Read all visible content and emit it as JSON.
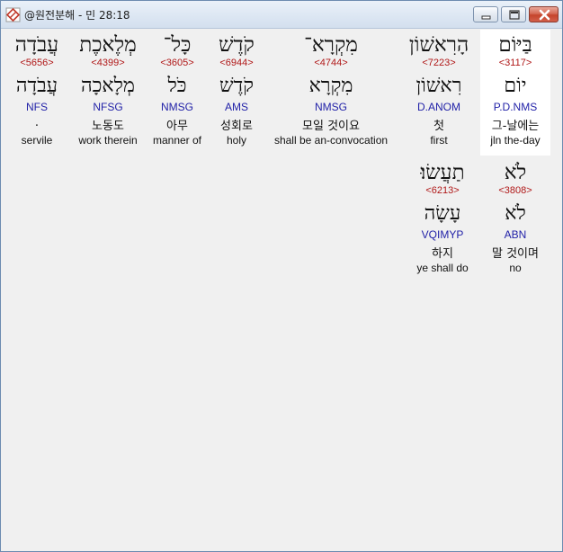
{
  "window": {
    "title": "@원전분해 - 민 28:18",
    "icon": "diamond-document-icon"
  },
  "rows": [
    {
      "words": [
        {
          "heb": "בַּיּוֹם",
          "strong": "<3117>",
          "lex": "יוֹם",
          "morph": "P.D.NMS",
          "kor": "그-날에는",
          "eng": "jln the-day",
          "selected": true
        },
        {
          "heb": "הָרִאשׁוֹן",
          "strong": "<7223>",
          "lex": "רִאשׁוֹן",
          "morph": "D.ANOM",
          "kor": "첫",
          "eng": "first",
          "selected": false
        },
        {
          "heb": "מִקְרָא־",
          "strong": "<4744>",
          "lex": "מִקְרָא",
          "morph": "NMSG",
          "kor": "모일 것이요",
          "eng": "shall be an-convocation",
          "selected": false
        },
        {
          "heb": "קֹדֶשׁ",
          "strong": "<6944>",
          "lex": "קֹדֶשׁ",
          "morph": "AMS",
          "kor": "성회로",
          "eng": "holy",
          "selected": false
        },
        {
          "heb": "כָּל־",
          "strong": "<3605>",
          "lex": "כֹּל",
          "morph": "NMSG",
          "kor": "아무",
          "eng": "manner of",
          "selected": false
        },
        {
          "heb": "מְלֶאכֶת",
          "strong": "<4399>",
          "lex": "מְלָאכָה",
          "morph": "NFSG",
          "kor": "노동도",
          "eng": "work therein",
          "selected": false
        },
        {
          "heb": "עֲבֹדָה",
          "strong": "<5656>",
          "lex": "עֲבֹדָה",
          "morph": "NFS",
          "kor": ".",
          "eng": "servile",
          "selected": false
        }
      ]
    },
    {
      "words": [
        {
          "heb": "לֹא",
          "strong": "<3808>",
          "lex": "לֹא",
          "morph": "ABN",
          "kor": "말 것이며",
          "eng": "no",
          "selected": false
        },
        {
          "heb": "תַעֲשׂוּ׃",
          "strong": "<6213>",
          "lex": "עָשָׂה",
          "morph": "VQIMYP",
          "kor": "하지",
          "eng": "ye shall do",
          "selected": false
        }
      ]
    }
  ]
}
